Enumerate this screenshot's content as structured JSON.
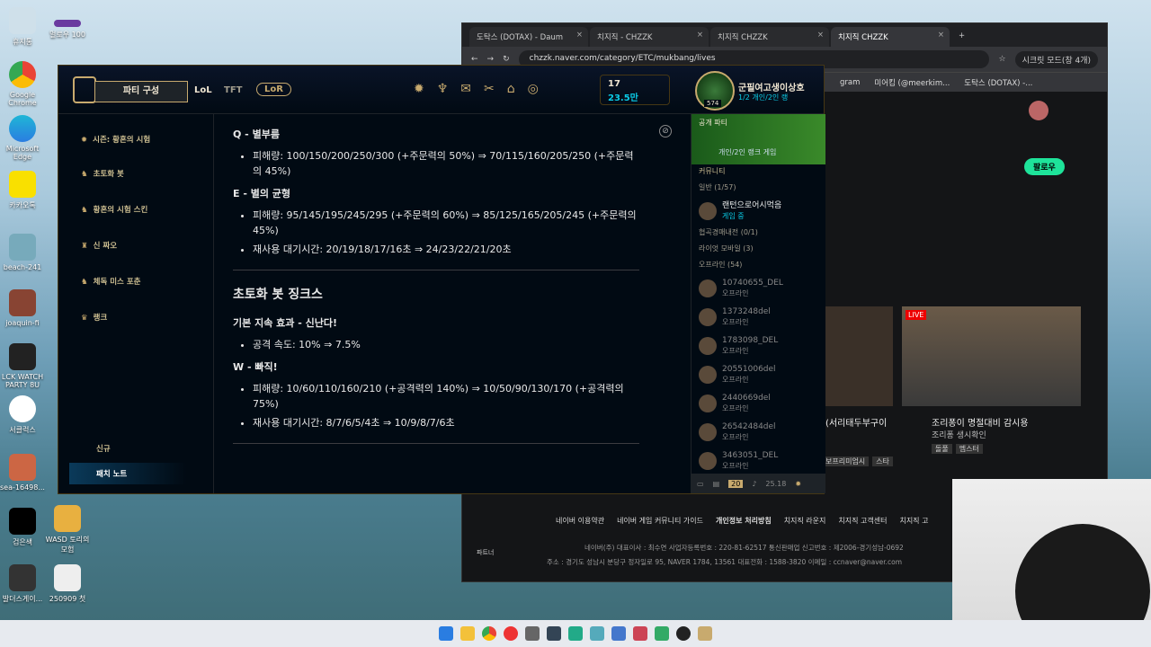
{
  "desktop": {
    "icons": [
      "휴지통",
      "멀로우 100",
      "Google Chrome",
      "Microsoft Edge",
      "카카오톡",
      "beach-241",
      "joaquin-fi",
      "LCK WATCH PARTY 8U",
      "서클럭스",
      "sea-16498...",
      "검은색",
      "WASD 토리의 모험",
      "발더스게이...",
      "250909 첫"
    ]
  },
  "chrome": {
    "tabs": [
      "도탁스 (DOTAX) - Daum",
      "치지직 - CHZZK",
      "치지직 CHZZK",
      "치지직 CHZZK"
    ],
    "url": "chzzk.naver.com/category/ETC/mukbang/lives",
    "secret": "시크릿 모드(창 4개)",
    "bookmarks": [
      "gram",
      "미어킴 (@meerkim...",
      "도탁스 (DOTAX) -..."
    ],
    "follow": "팔로우",
    "live_badge": "LIVE",
    "stream1_title": "(서리태두부구이",
    "stream2_title": "조리퐁이 명절대비 감시용",
    "stream2_channel": "조리퐁 생시확인",
    "tags": [
      "돌풀",
      "멤스터"
    ],
    "tags_left": [
      "보프리미엄시",
      "스타"
    ],
    "footer_links": [
      "네이버 이용약관",
      "네이버 게임 커뮤니티 가이드",
      "개인정보 처리방침",
      "치지직 라운지",
      "치지직 고객센터",
      "치지직 고"
    ],
    "footer_info": "네이버(주) 대표이사 : 최수연  사업자등록번호 : 220-81-62517  통신판매업 신고번호 : 제2006-경기성남-0692",
    "footer_addr": "주소 : 경기도 성남시 분당구 정자일로 95, NAVER 1784, 13561  대표전화 : 1588-3820  이메일 : ccnaver@naver.com",
    "side_label": "파트너"
  },
  "league": {
    "party_btn": "파티 구성",
    "nav": [
      "LoL",
      "TFT",
      "LoR"
    ],
    "rp": "17",
    "be": "23.5만",
    "player": "군필여고생이상호",
    "status": "1/2 개인/2인 랭",
    "level": "574",
    "left_nav": [
      "시즌: 황혼의 시험",
      "초토화 봇",
      "황혼의 시험 스킨",
      "신 짜오",
      "체독 미스 포춘",
      "랭크",
      "신규",
      "패치 노트"
    ],
    "content": {
      "q_title": "Q - 별부름",
      "q_li1": "피해량: 100/150/200/250/300 (+주문력의 50%) ⇒ 70/115/160/205/250 (+주문력의 45%)",
      "e_title": "E - 별의 균형",
      "e_li1": "피해량: 95/145/195/245/295 (+주문력의 60%) ⇒ 85/125/165/205/245 (+주문력의 45%)",
      "e_li2": "재사용 대기시간: 20/19/18/17/16초 ⇒ 24/23/22/21/20초",
      "section": "초토화 봇 징크스",
      "p_title": "기본 지속 효과 - 신난다!",
      "p_li1": "공격 속도: 10% ⇒ 7.5%",
      "w_title": "W - 빠직!",
      "w_li1": "피해량: 10/60/110/160/210 (+공격력의 140%) ⇒ 10/50/90/130/170 (+공격력의 75%)",
      "w_li2": "재사용 대기시간: 8/7/6/5/4초 ⇒ 10/9/8/7/6초"
    },
    "friends": {
      "party_label": "공개 파티",
      "party_sub": "개인/2인 랭크 게임",
      "community": "커뮤니티",
      "general": "일반 (1/57)",
      "online_name": "랜턴으로어시먹음",
      "online_status": "게임 중",
      "groups": [
        "협곡경매내전 (0/1)",
        "라이엇 모바일 (3)",
        "오프라인 (54)"
      ],
      "offline": [
        "10740655_DEL",
        "1373248del",
        "1783098_DEL",
        "20551006del",
        "2440669del",
        "26542484del",
        "3463051_DEL"
      ],
      "offline_status": "오프라인",
      "badge": "20",
      "time": "25.18"
    }
  },
  "taskbar": {
    "count": 13
  }
}
